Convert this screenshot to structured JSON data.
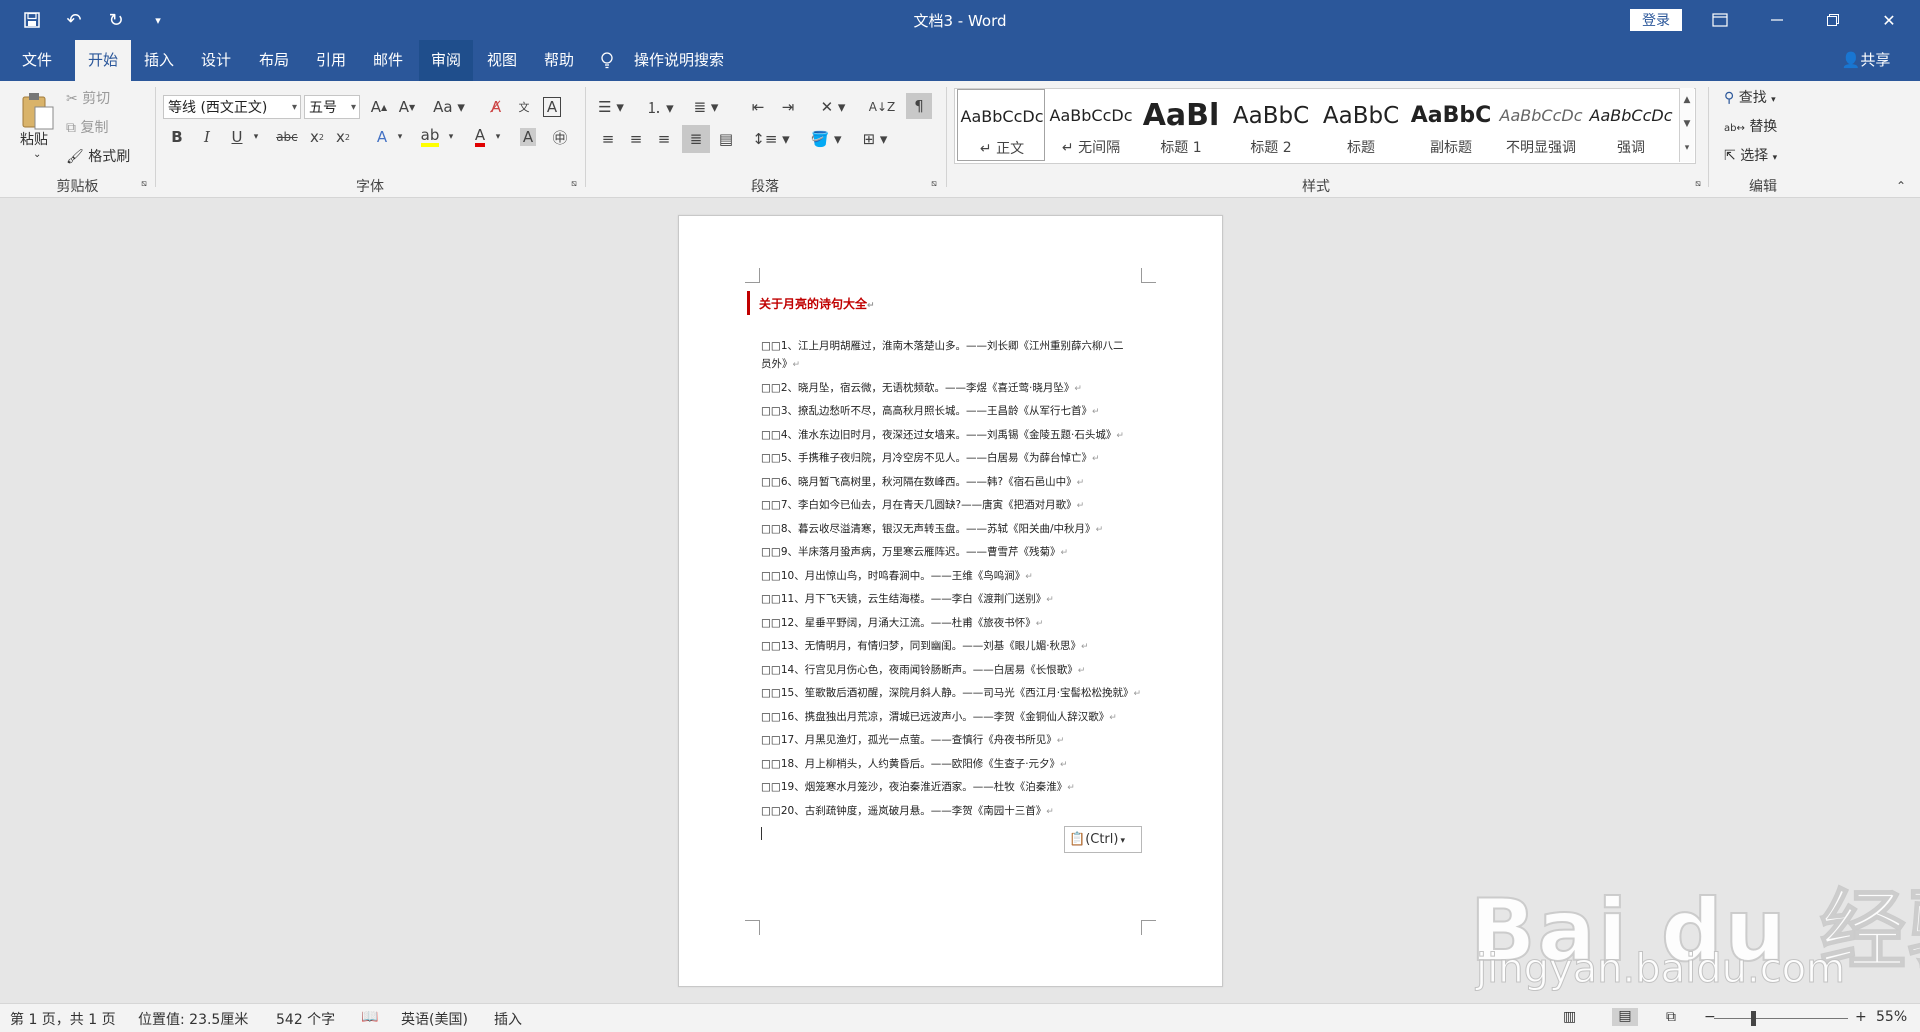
{
  "window": {
    "title": "文档3  -  Word",
    "login": "登录"
  },
  "tabs": [
    "文件",
    "开始",
    "插入",
    "设计",
    "布局",
    "引用",
    "邮件",
    "审阅",
    "视图",
    "帮助"
  ],
  "tell_me": "操作说明搜索",
  "share": "共享",
  "clipboard": {
    "paste": "粘贴",
    "cut": "剪切",
    "copy": "复制",
    "format_painter": "格式刷",
    "label": "剪贴板"
  },
  "font": {
    "name": "等线 (西文正文)",
    "size": "五号",
    "label": "字体"
  },
  "paragraph": {
    "label": "段落"
  },
  "styles": {
    "label": "样式",
    "items": [
      {
        "preview": "AaBbCcDc",
        "name": "↵ 正文"
      },
      {
        "preview": "AaBbCcDc",
        "name": "↵ 无间隔"
      },
      {
        "preview": "AaBl",
        "name": "标题 1"
      },
      {
        "preview": "AaBbC",
        "name": "标题 2"
      },
      {
        "preview": "AaBbC",
        "name": "标题"
      },
      {
        "preview": "AaBbC",
        "name": "副标题"
      },
      {
        "preview": "AaBbCcDc",
        "name": "不明显强调"
      },
      {
        "preview": "AaBbCcDc",
        "name": "强调"
      }
    ]
  },
  "editing": {
    "find": "查找",
    "replace": "替换",
    "select": "选择",
    "label": "编辑"
  },
  "document": {
    "title": "关于月亮的诗句大全",
    "lines": [
      "□□1、江上月明胡雁过，淮南木落楚山多。——刘长卿《江州重别薛六柳八二",
      "员外》",
      "□□2、晓月坠，宿云微，无语枕频欹。——李煜《喜迁莺·晓月坠》",
      "□□3、撩乱边愁听不尽，高高秋月照长城。——王昌龄《从军行七首》",
      "□□4、淮水东边旧时月，夜深还过女墙来。——刘禹锡《金陵五题·石头城》",
      "□□5、手携稚子夜归院，月冷空房不见人。——白居易《为薛台悼亡》",
      "□□6、晓月暂飞高树里，秋河隔在数峰西。——韩?《宿石邑山中》",
      "□□7、李白如今已仙去，月在青天几圆缺?——唐寅《把酒对月歌》",
      "□□8、暮云收尽溢清寒，银汉无声转玉盘。——苏轼《阳关曲/中秋月》",
      "□□9、半床落月蛩声病，万里寒云雁阵迟。——曹雪芹《残菊》",
      "□□10、月出惊山鸟，时鸣春涧中。——王维《鸟鸣涧》",
      "□□11、月下飞天镜，云生结海楼。——李白《渡荆门送别》",
      "□□12、星垂平野阔，月涌大江流。——杜甫《旅夜书怀》",
      "□□13、无情明月，有情归梦，同到幽闺。——刘基《眼儿媚·秋思》",
      "□□14、行宫见月伤心色，夜雨闻铃肠断声。——白居易《长恨歌》",
      "□□15、笙歌散后酒初醒，深院月斜人静。——司马光《西江月·宝髻松松挽就》",
      "□□16、携盘独出月荒凉，渭城已远波声小。——李贺《金铜仙人辞汉歌》",
      "□□17、月黑见渔灯，孤光一点萤。——查慎行《舟夜书所见》",
      "□□18、月上柳梢头，人约黄昏后。——欧阳修《生查子·元夕》",
      "□□19、烟笼寒水月笼沙，夜泊秦淮近酒家。——杜牧《泊秦淮》",
      "□□20、古刹疏钟度，遥岚破月悬。——李贺《南园十三首》"
    ],
    "paste_options": "(Ctrl)"
  },
  "status": {
    "page": "第 1 页，共 1 页",
    "position": "位置值: 23.5厘米",
    "words": "542 个字",
    "language": "英语(美国)",
    "mode": "插入",
    "zoom": "55%"
  },
  "watermark": {
    "logo": "Bai du 经验",
    "url": "jingyan.baidu.com"
  },
  "colors": {
    "accent": "#2b579a",
    "title_red": "#c00000"
  }
}
